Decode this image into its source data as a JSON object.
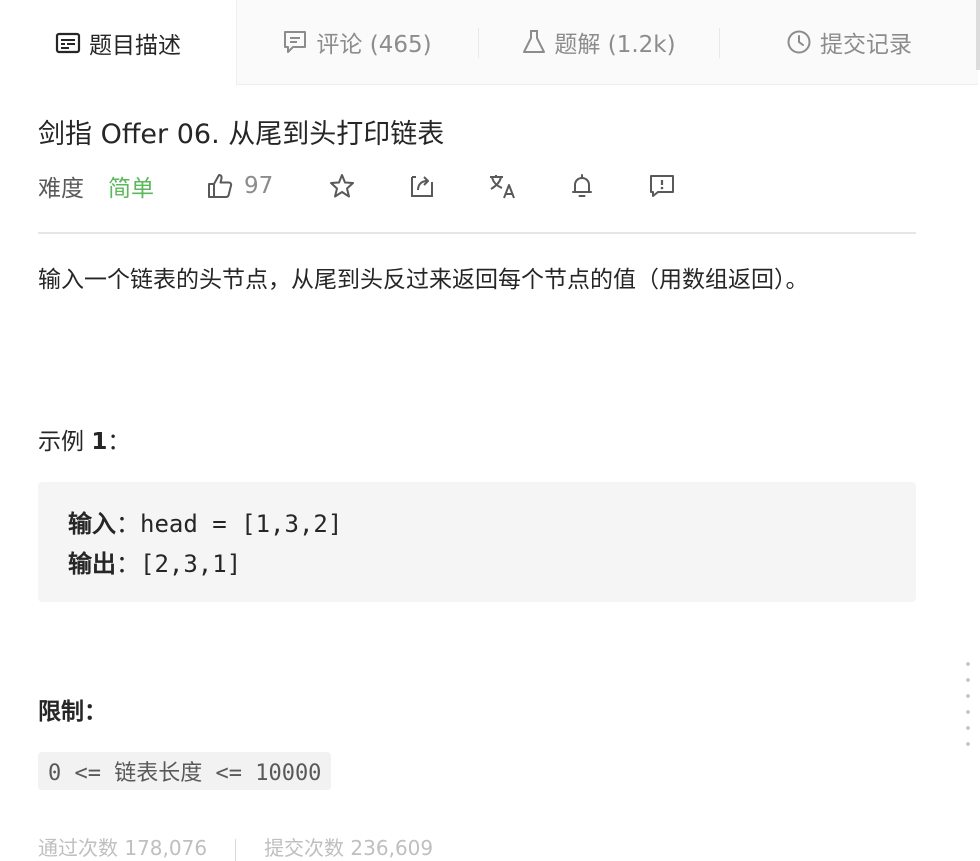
{
  "tabs": [
    {
      "label": "题目描述",
      "icon": "description-icon"
    },
    {
      "label": "评论 (465)",
      "icon": "comment-icon"
    },
    {
      "label": "题解 (1.2k)",
      "icon": "flask-icon"
    },
    {
      "label": "提交记录",
      "icon": "clock-icon"
    }
  ],
  "problem": {
    "title": "剑指 Offer 06. 从尾到头打印链表",
    "difficulty_label": "难度",
    "difficulty_value": "简单",
    "likes": "97",
    "description": "输入一个链表的头节点，从尾到头反过来返回每个节点的值（用数组返回）。",
    "example_title": "示例 ",
    "example_number": "1",
    "example_colon": "：",
    "example_input_label": "输入",
    "example_input_value": "：head = [1,3,2]",
    "example_output_label": "输出",
    "example_output_value": "：[2,3,1]",
    "limits_title": "限制：",
    "limit_text": "0 <= 链表长度 <= 10000",
    "stats_passed": "通过次数 178,076",
    "stats_submitted": "提交次数 236,609"
  },
  "colors": {
    "easy": "#5cb85c",
    "muted": "#8c8c8c"
  }
}
